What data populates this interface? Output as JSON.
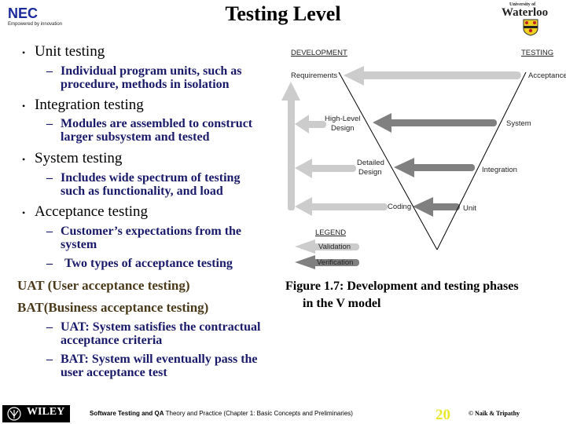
{
  "header": {
    "title": "Testing Level",
    "left_logo": {
      "name": "NEC",
      "tagline": "Empowered by innovation",
      "color": "#1a2a9a"
    },
    "right_logo": {
      "top_text": "University of",
      "main_text": "Waterloo"
    }
  },
  "content": {
    "bullets": [
      {
        "label": "Unit testing",
        "subs": [
          "Individual program units, such as",
          "procedure, methods in isolation"
        ]
      },
      {
        "label": "Integration testing",
        "subs": [
          "Modules are assembled to construct",
          "larger subsystem and tested"
        ]
      },
      {
        "label": "System testing",
        "subs": [
          "Includes wide spectrum of testing",
          "such as functionality, and load"
        ]
      },
      {
        "label": "Acceptance testing",
        "subs": [
          "Customer’s expectations from the",
          "system",
          "Two types of acceptance testing"
        ]
      }
    ],
    "acceptance_types": [
      "UAT (User acceptance testing)",
      "BAT(Business acceptance testing)"
    ],
    "acceptance_notes": [
      [
        "UAT: System satisfies the contractual",
        "acceptance criteria"
      ],
      [
        "BAT: System will eventually pass the",
        "user acceptance test"
      ]
    ],
    "bullet_char": "•",
    "dash_char": "–"
  },
  "diagram": {
    "dev_heading": "DEVELOPMENT",
    "test_heading": "TESTING",
    "dev_phases": [
      "Requirements",
      "High-Level",
      "Design",
      "Detailed",
      "Design",
      "Coding"
    ],
    "test_phases": [
      "Acceptance",
      "System",
      "Integration",
      "Unit"
    ],
    "legend_title": "LEGEND",
    "legend_items": [
      "Validation",
      "Verification"
    ],
    "colors": {
      "validation": "#cccccc",
      "verification": "#808080",
      "line": "#000000"
    },
    "caption_line1": "Figure 1.7: Development and testing phases",
    "caption_line2": "in the V model"
  },
  "footer": {
    "publisher": "WILEY",
    "book_title_bold": "Software Testing and QA",
    "book_title_rest": " Theory and Practice (Chapter 1: Basic Concepts and Preliminaries)",
    "page_number": "20",
    "copyright": "© Naik & Tripathy"
  }
}
